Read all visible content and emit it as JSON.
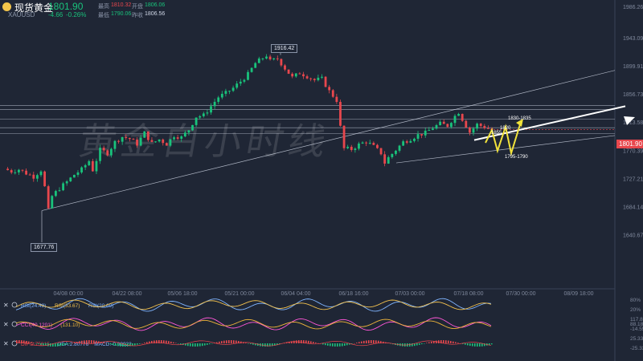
{
  "header": {
    "name": "现货黄金",
    "last": "1801.90",
    "code": "XAUUSD",
    "change": "-4.66",
    "change_pct": "-0.26%",
    "high_label": "最高",
    "high": "1810.32",
    "open_label": "开盘",
    "open": "1806.06",
    "low_label": "最低",
    "low": "1790.06",
    "prev_close_label": "昨收",
    "prev_close": "1806.56"
  },
  "watermark": "黄金白小时线",
  "chart_data": {
    "type": "candlestick",
    "title": "现货黄金 XAUUSD",
    "x_labels": [
      "04/08 00:00",
      "04/22 08:00",
      "05/06 18:00",
      "05/21 00:00",
      "06/04 04:00",
      "06/18 16:00",
      "07/03 00:00",
      "07/18 08:00",
      "07/30 00:00",
      "08/09 18:00"
    ],
    "y_ticks": [
      1640.67,
      1684.14,
      1727.21,
      1770.39,
      1813.58,
      1856.73,
      1899.91,
      1943.09
    ],
    "ylim": [
      1622,
      1994
    ],
    "top_tick": "1986.26",
    "current_price": "1801.90",
    "annotations": {
      "high": "1916.42",
      "low": "1677.76",
      "target_a": "1855",
      "target_b": "1820",
      "target_c": "1830-1835",
      "support": "1795-1790"
    },
    "price_path": [
      [
        0,
        1742
      ],
      [
        2,
        1738
      ],
      [
        4,
        1741
      ],
      [
        6,
        1735
      ],
      [
        8,
        1730
      ],
      [
        10,
        1740
      ],
      [
        11,
        1714
      ],
      [
        12,
        1678
      ],
      [
        13,
        1700
      ],
      [
        15,
        1712
      ],
      [
        17,
        1722
      ],
      [
        19,
        1733
      ],
      [
        21,
        1741
      ],
      [
        23,
        1754
      ],
      [
        24,
        1740
      ],
      [
        26,
        1771
      ],
      [
        28,
        1766
      ],
      [
        30,
        1783
      ],
      [
        32,
        1791
      ],
      [
        34,
        1788
      ],
      [
        36,
        1780
      ],
      [
        38,
        1797
      ],
      [
        40,
        1781
      ],
      [
        42,
        1787
      ],
      [
        44,
        1780
      ],
      [
        46,
        1793
      ],
      [
        48,
        1790
      ],
      [
        50,
        1802
      ],
      [
        52,
        1822
      ],
      [
        54,
        1824
      ],
      [
        56,
        1838
      ],
      [
        58,
        1852
      ],
      [
        60,
        1858
      ],
      [
        62,
        1866
      ],
      [
        64,
        1876
      ],
      [
        66,
        1887
      ],
      [
        68,
        1904
      ],
      [
        70,
        1912
      ],
      [
        71,
        1916
      ],
      [
        72,
        1907
      ],
      [
        74,
        1911
      ],
      [
        76,
        1896
      ],
      [
        78,
        1882
      ],
      [
        80,
        1889
      ],
      [
        82,
        1884
      ],
      [
        84,
        1878
      ],
      [
        86,
        1880
      ],
      [
        88,
        1861
      ],
      [
        90,
        1847
      ],
      [
        91,
        1806
      ],
      [
        92,
        1773
      ],
      [
        94,
        1772
      ],
      [
        96,
        1779
      ],
      [
        98,
        1784
      ],
      [
        100,
        1776
      ],
      [
        102,
        1766
      ],
      [
        103,
        1751
      ],
      [
        104,
        1759
      ],
      [
        106,
        1771
      ],
      [
        108,
        1783
      ],
      [
        110,
        1788
      ],
      [
        112,
        1794
      ],
      [
        114,
        1797
      ],
      [
        116,
        1805
      ],
      [
        118,
        1811
      ],
      [
        120,
        1808
      ],
      [
        122,
        1823
      ],
      [
        123,
        1829
      ],
      [
        124,
        1818
      ],
      [
        126,
        1798
      ],
      [
        128,
        1810
      ],
      [
        130,
        1806
      ],
      [
        132,
        1802
      ]
    ],
    "indicators": [
      {
        "name": "RSI",
        "labels": [
          "RSI(24.42)",
          "RSI(33.67)",
          "RSI(20.69)"
        ],
        "axis": [
          "80%",
          "20%"
        ]
      },
      {
        "name": "CCI",
        "labels": [
          "CCI(40.1201)",
          "(131.10)"
        ],
        "axis": [
          "117.811",
          "88.1834",
          "-14.5581"
        ]
      },
      {
        "name": "MACD",
        "labels": [
          "DIF:2.75815",
          "DEA:2.80776",
          "MACD:-0.09922"
        ],
        "axis": [
          "25.33118",
          "-25.33118"
        ]
      }
    ]
  },
  "colors": {
    "up": "#19c27b",
    "down": "#e8474d",
    "bg": "#1f2635",
    "grid": "#2e3547",
    "arrow": "#f1e23b"
  }
}
